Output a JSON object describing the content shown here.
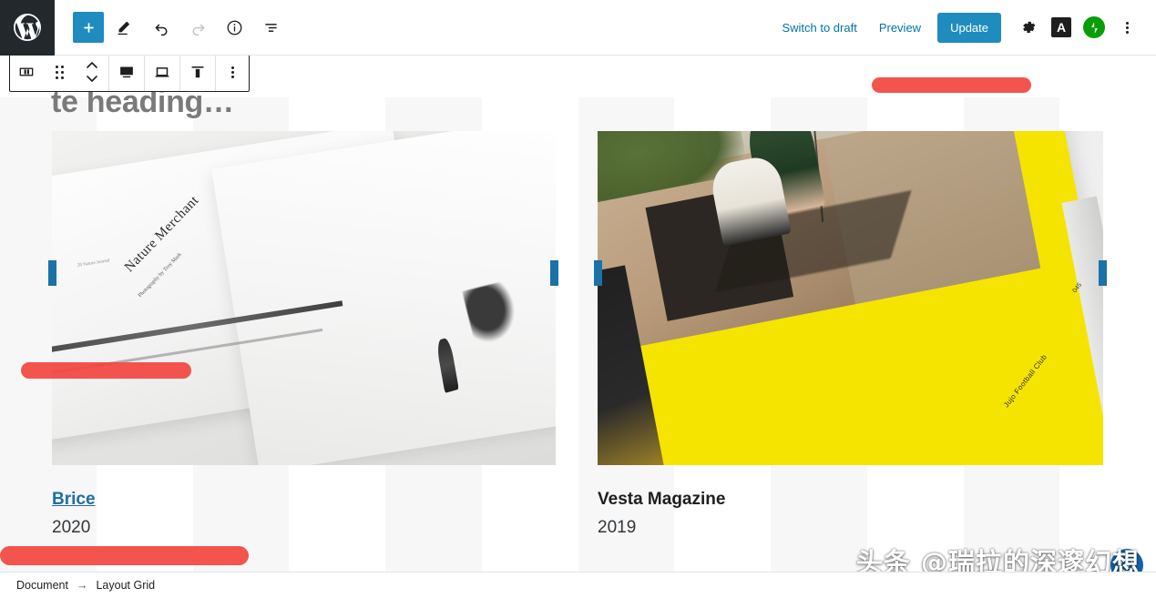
{
  "topbar": {
    "logo_icon": "wordpress-logo-icon",
    "add_block_label": "+",
    "add_block_icon": "plus-icon",
    "edit_icon": "pencil-icon",
    "undo_icon": "undo-arrow-icon",
    "redo_icon": "redo-arrow-icon",
    "info_icon": "info-circle-icon",
    "listview_icon": "list-view-icon",
    "switch_to_draft": "Switch to draft",
    "preview": "Preview",
    "update": "Update",
    "settings_icon": "gear-icon",
    "yoast_badge": "A",
    "jetpack_icon": "jetpack-bolt-icon",
    "more_icon": "vertical-ellipsis-icon"
  },
  "block_toolbar": {
    "layout_grid_icon": "layout-grid-icon",
    "drag_icon": "drag-handle-icon",
    "move_icon": "move-up-down-icon",
    "desktop_icon": "desktop-view-icon",
    "tablet_icon": "tablet-view-icon",
    "mobile_icon": "mobile-view-icon",
    "options_icon": "vertical-ellipsis-icon"
  },
  "canvas": {
    "heading_placeholder": "te heading…",
    "grid_columns": 12
  },
  "columns": [
    {
      "image_alt": "open-book-nature-merchant",
      "image_title": "Nature Merchant",
      "image_subtitle": "Photography by Troy Mark",
      "image_folio": "20  Nature Journal",
      "caption_title": "Brice",
      "caption_is_link": true,
      "caption_year": "2020"
    },
    {
      "image_alt": "yellow-magazine-jujo-football-club",
      "image_label": "Jujo Football Club",
      "image_folio": "045",
      "caption_title": "Vesta Magazine",
      "caption_is_link": false,
      "caption_year": "2019"
    }
  ],
  "handles": {
    "resize_icon": "column-resize-handle-icon"
  },
  "annotations": {
    "stroke_color": "#f2463f",
    "count": 3
  },
  "fab": {
    "icon": "help-support-icon"
  },
  "watermark": {
    "text": "头条 @瑞拉的深邃幻想"
  },
  "statusbar": {
    "crumb_document": "Document",
    "crumb_arrow": "→",
    "crumb_block": "Layout Grid"
  },
  "colors": {
    "wp_dark": "#23282d",
    "accent_blue": "#1e8cbe",
    "link_blue": "#0073aa",
    "handle_blue": "#1a72a8",
    "annotation_red": "#f2463f",
    "jetpack_green": "#069e08",
    "grid_shade": "#f7f7f7"
  }
}
